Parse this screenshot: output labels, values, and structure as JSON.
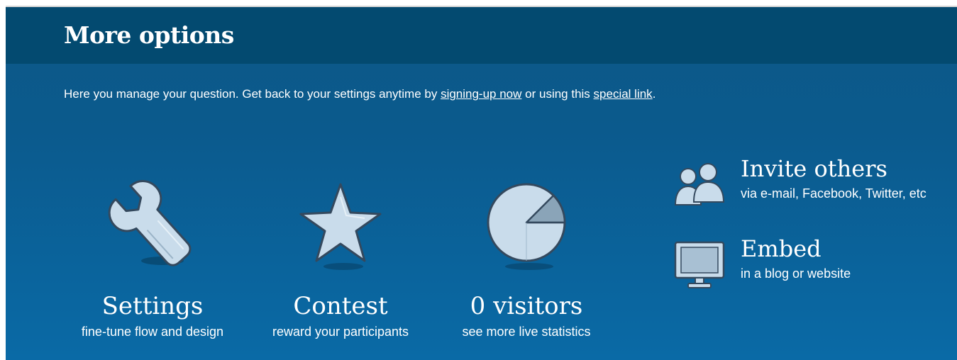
{
  "header": {
    "title": "More options"
  },
  "intro": {
    "text_before": "Here you manage your question. Get back to your settings anytime by ",
    "link_signup": "signing-up now",
    "text_middle": " or using this ",
    "link_special": "special link",
    "text_after": "."
  },
  "options": [
    {
      "icon": "wrench-icon",
      "title": "Settings",
      "subtitle": "fine-tune flow and design"
    },
    {
      "icon": "star-icon",
      "title": "Contest",
      "subtitle": "reward your participants"
    },
    {
      "icon": "pie-chart-icon",
      "title": "0 visitors",
      "subtitle": "see more live statistics"
    }
  ],
  "side_options": [
    {
      "icon": "people-icon",
      "title": "Invite others",
      "subtitle": "via e-mail, Facebook, Twitter, etc"
    },
    {
      "icon": "monitor-icon",
      "title": "Embed",
      "subtitle": "in a blog or website"
    }
  ],
  "colors": {
    "header_bg": "#034a70",
    "panel_bg": "#0b5a8d",
    "text": "#ffffff",
    "icon_fill": "#c9dceb"
  }
}
